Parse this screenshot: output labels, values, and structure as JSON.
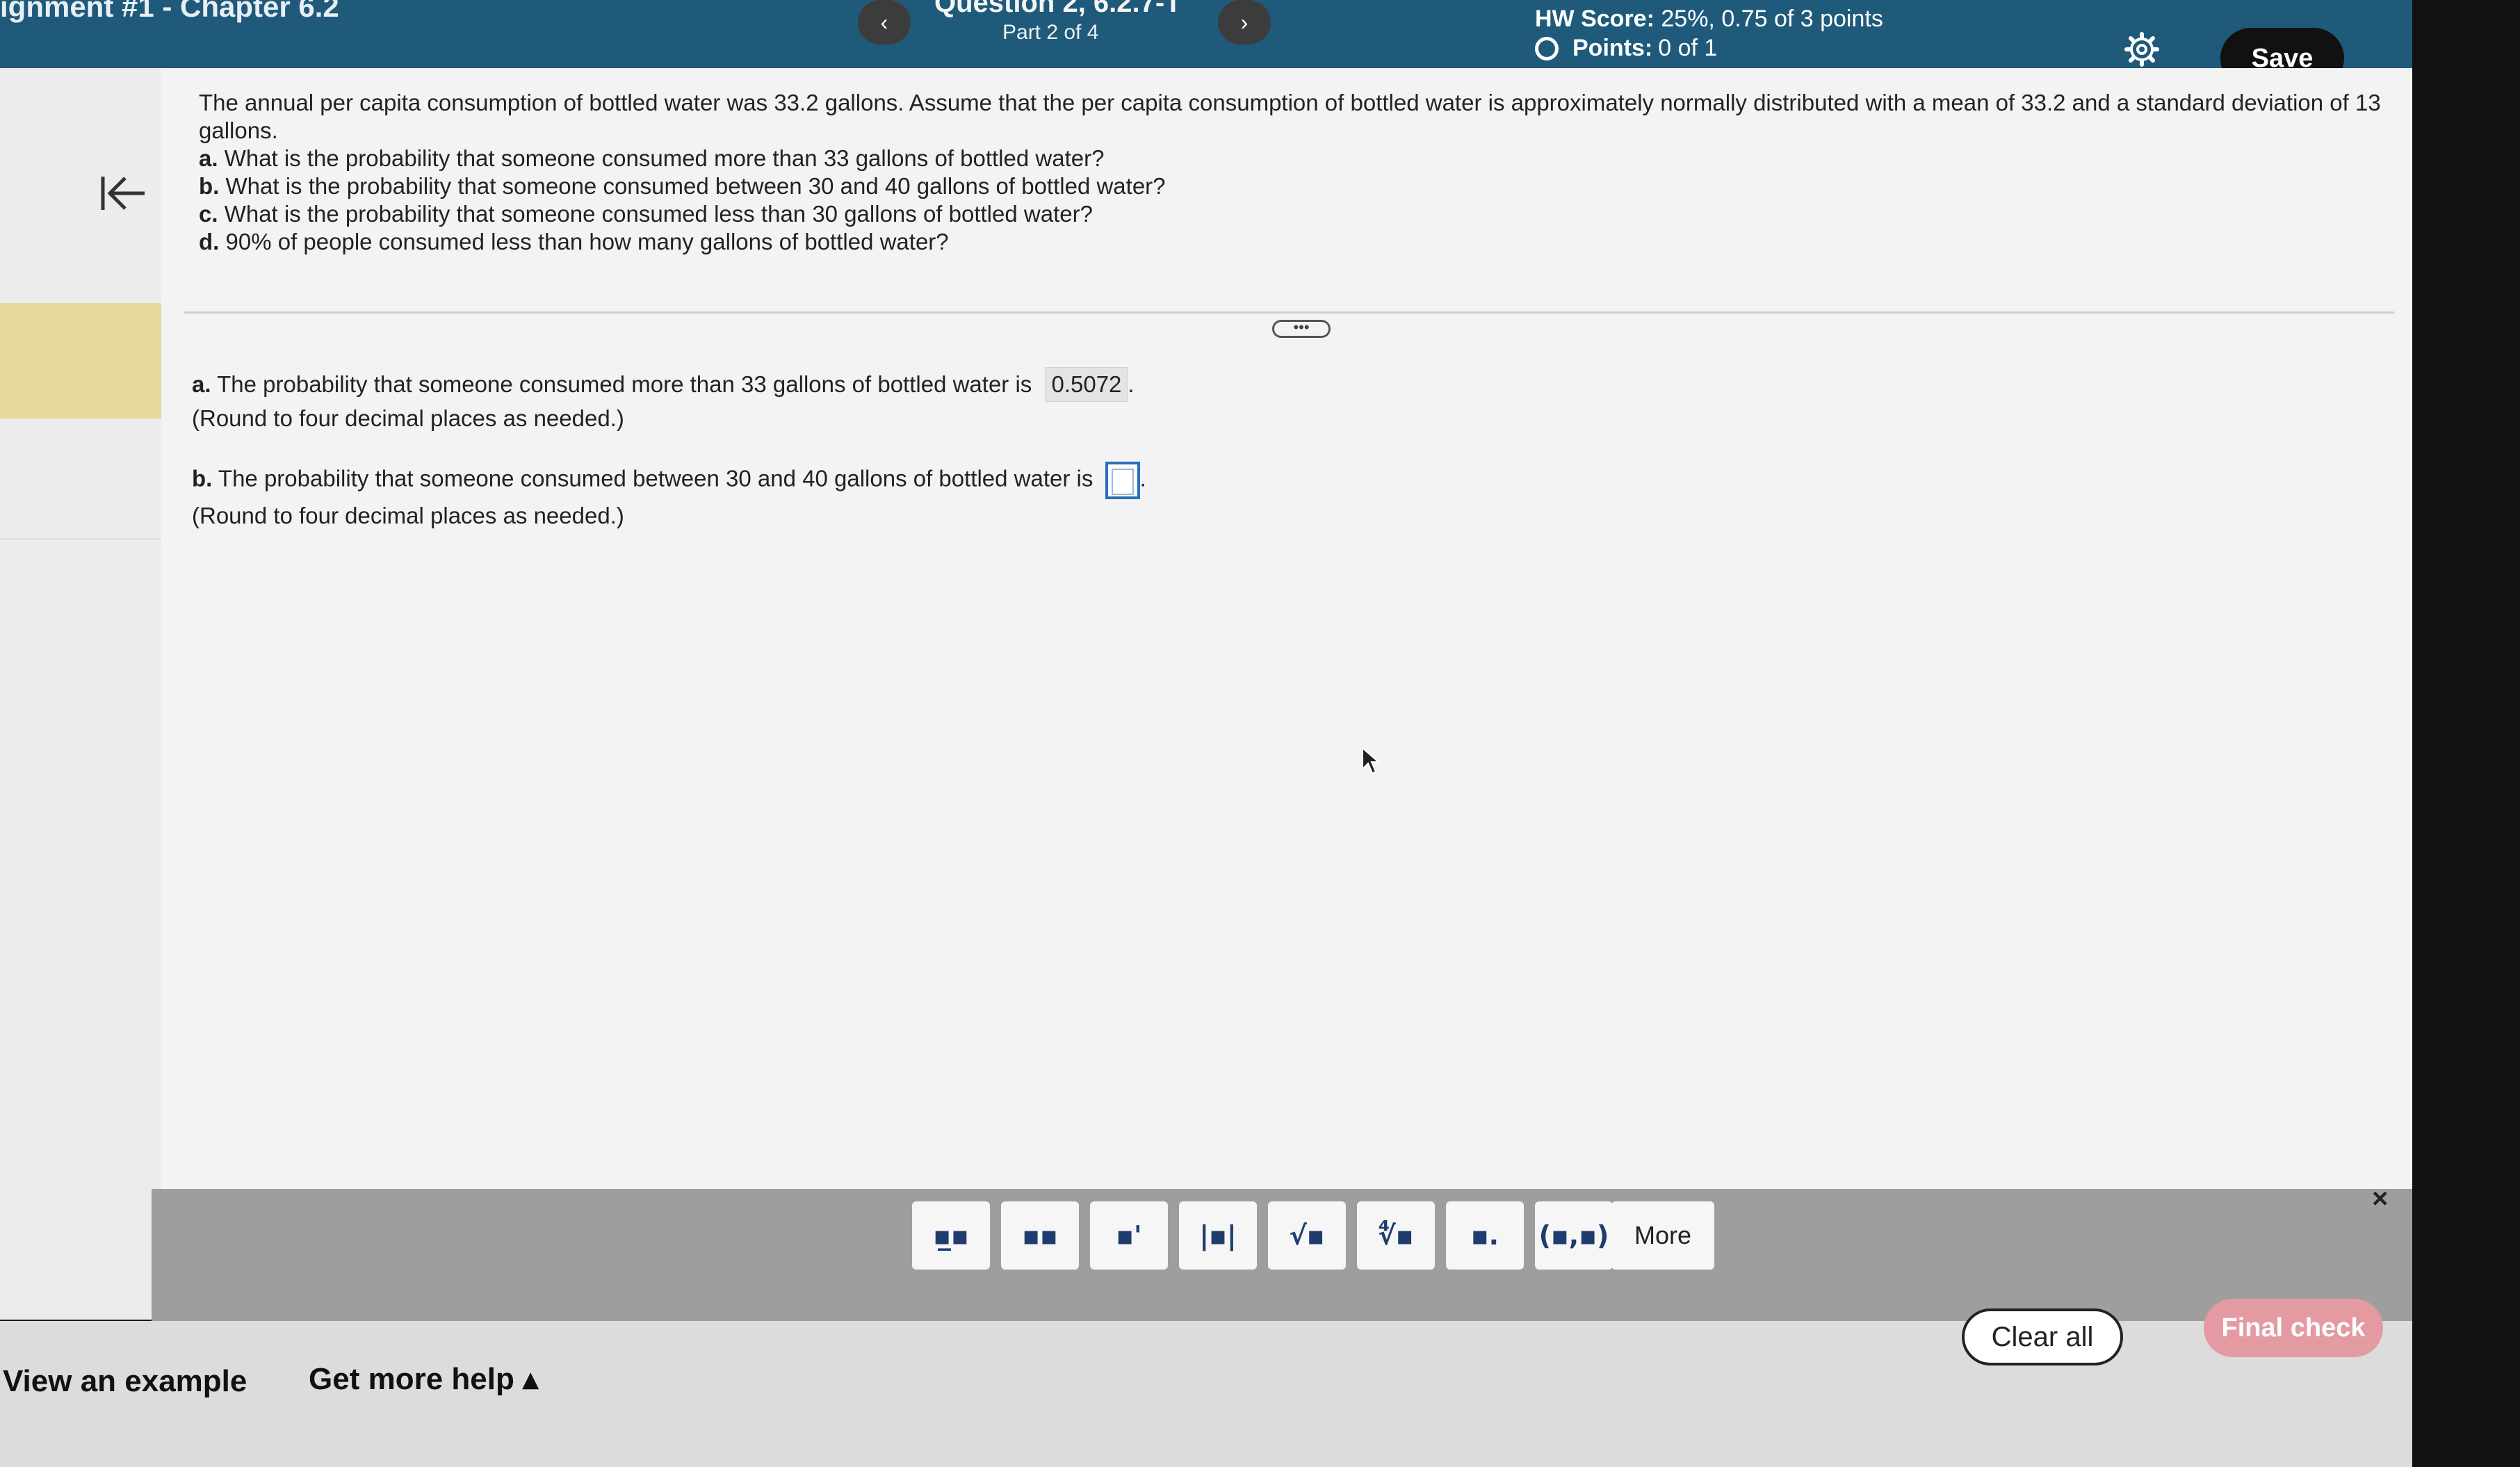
{
  "header": {
    "assignment_title": "ignment #1 - Chapter 6.2",
    "question_title": "Question 2, 6.2.7-T",
    "part_label": "Part 2 of 4",
    "prev_label": "‹",
    "next_label": "›",
    "hw_score_label": "HW Score:",
    "hw_score_value": "25%, 0.75 of 3 points",
    "points_label": "Points:",
    "points_value": "0 of 1",
    "save_label": "Save"
  },
  "question": {
    "intro": "The annual per capita consumption of bottled water was 33.2 gallons. Assume that the per capita consumption of bottled water is approximately normally distributed with a mean of 33.2 and a standard deviation of 13 gallons.",
    "parts": [
      {
        "letter": "a.",
        "text": "What is the probability that someone consumed more than 33 gallons of bottled water?"
      },
      {
        "letter": "b.",
        "text": "What is the probability that someone consumed between 30 and 40 gallons of bottled water?"
      },
      {
        "letter": "c.",
        "text": "What is the probability that someone consumed less than 30 gallons of bottled water?"
      },
      {
        "letter": "d.",
        "text": "90% of people consumed less than how many gallons of bottled water?"
      }
    ]
  },
  "handle_label": "•••",
  "answers": {
    "a_letter": "a.",
    "a_text": "The probability that someone consumed more than 33 gallons of bottled water is",
    "a_value": "0.5072",
    "a_hint": "(Round to four decimal places as needed.)",
    "b_letter": "b.",
    "b_text": "The probability that someone consumed between 30 and 40 gallons of bottled water is",
    "b_hint": "(Round to four decimal places as needed.)"
  },
  "toolbar": {
    "tools": [
      {
        "name": "fraction-tool",
        "glyph": "▪̲▪"
      },
      {
        "name": "mixed-number-tool",
        "glyph": "▪▪"
      },
      {
        "name": "exponent-tool",
        "glyph": "▪'"
      },
      {
        "name": "absolute-value-tool",
        "glyph": "|▪|"
      },
      {
        "name": "square-root-tool",
        "glyph": "√▪"
      },
      {
        "name": "nth-root-tool",
        "glyph": "∜▪"
      },
      {
        "name": "subscript-tool",
        "glyph": "▪."
      },
      {
        "name": "ordered-pair-tool",
        "glyph": "(▪,▪)"
      }
    ],
    "more_label": "More",
    "close_label": "×"
  },
  "footer": {
    "view_example": "View an example",
    "get_help": "Get more help ▴",
    "clear_all": "Clear all",
    "final_check": "Final check"
  }
}
